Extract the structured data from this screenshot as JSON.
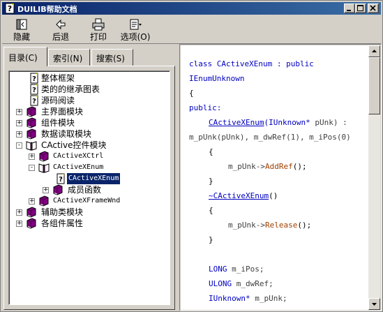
{
  "window": {
    "title": "DUILIB帮助文档",
    "controls": [
      "minimize-icon",
      "maximize-icon",
      "close-icon"
    ]
  },
  "toolbar": {
    "buttons": [
      {
        "label": "隐藏",
        "icon": "hide-pane-icon"
      },
      {
        "label": "后退",
        "icon": "back-arrow-icon"
      },
      {
        "label": "打印",
        "icon": "printer-icon"
      },
      {
        "label": "选项(O)",
        "icon": "options-icon"
      }
    ]
  },
  "tabs": [
    {
      "label": "目录(C)",
      "active": true
    },
    {
      "label": "索引(N)",
      "active": false
    },
    {
      "label": "搜索(S)",
      "active": false
    }
  ],
  "tree": [
    {
      "label": "整体框架",
      "icon": "help-page-icon",
      "expander": ""
    },
    {
      "label": "类的的继承图表",
      "icon": "help-page-icon",
      "expander": ""
    },
    {
      "label": "源码阅读",
      "icon": "help-page-icon",
      "expander": ""
    },
    {
      "label": "主界面模块",
      "icon": "closed-book-icon",
      "expander": "+"
    },
    {
      "label": "组件模块",
      "icon": "closed-book-icon",
      "expander": "+"
    },
    {
      "label": "数据读取模块",
      "icon": "closed-book-icon",
      "expander": "+"
    },
    {
      "label": "CActive控件模块",
      "icon": "open-book-icon",
      "expander": "-"
    },
    {
      "label": "CActiveXCtrl",
      "icon": "closed-book-icon",
      "expander": "+"
    },
    {
      "label": "CActiveXEnum",
      "icon": "open-book-icon",
      "expander": "-"
    },
    {
      "label": "CActiveXEnum",
      "icon": "help-page-icon",
      "expander": "",
      "selected": true
    },
    {
      "label": "成员函数",
      "icon": "closed-book-icon",
      "expander": "+"
    },
    {
      "label": "CActiveXFrameWnd",
      "icon": "closed-book-icon",
      "expander": "+"
    },
    {
      "label": "辅助类模块",
      "icon": "closed-book-icon",
      "expander": "+"
    },
    {
      "label": "各组件属性",
      "icon": "closed-book-icon",
      "expander": "+"
    }
  ],
  "code": {
    "l1": {
      "a": "class CActiveXEnum : public"
    },
    "l2": {
      "a": "IEnumUnknown"
    },
    "l3": {
      "a": "{"
    },
    "l4": {
      "a": "public:"
    },
    "l5": {
      "a": "CActiveXEnum",
      "b": "(IUnknown*",
      "c": " pUnk) :"
    },
    "l6": {
      "a": "m_pUnk(pUnk), m_dwRef(1), m_iPos(0)"
    },
    "l7": {
      "a": "{"
    },
    "l8": {
      "a": "m_pUnk->",
      "b": "AddRef",
      "c": "();"
    },
    "l9": {
      "a": "}"
    },
    "l10": {
      "a": "~CActiveXEnum",
      "b": "()"
    },
    "l11": {
      "a": "{"
    },
    "l12": {
      "a": "m_pUnk->",
      "b": "Release",
      "c": "();"
    },
    "l13": {
      "a": "}"
    },
    "l14": {
      "a": "LONG",
      "b": " m_iPos;"
    },
    "l15": {
      "a": "ULONG",
      "b": " m_dwRef;"
    },
    "l16": {
      "a": "IUnknown*",
      "b": " m_pUnk;"
    }
  },
  "colors": {
    "titlebar_start": "#0a246a",
    "titlebar_end": "#3a6ea5",
    "keyword": "#0000c0",
    "function": "#a04000",
    "selection": "#0a246a"
  }
}
